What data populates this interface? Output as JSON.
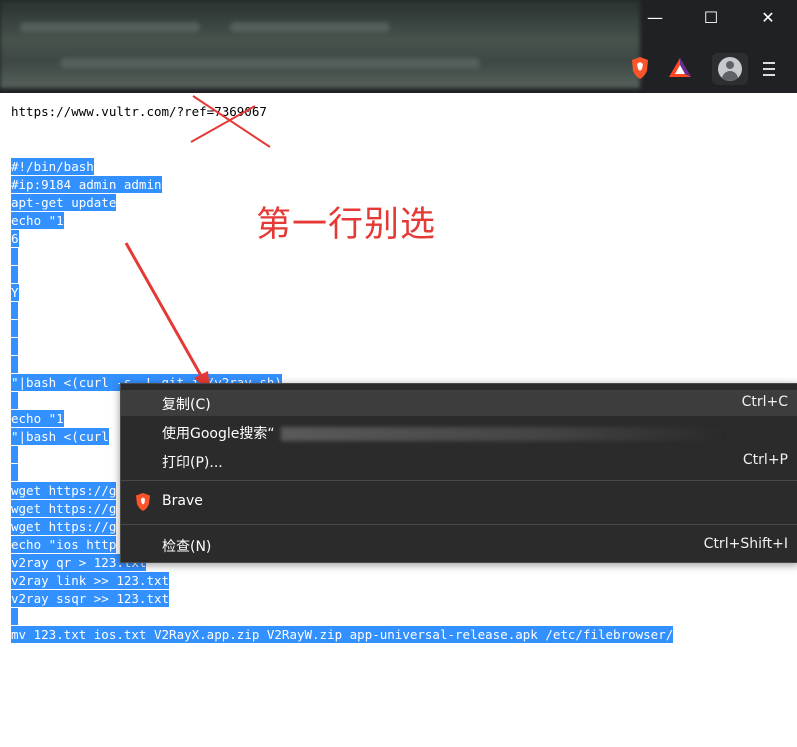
{
  "window": {
    "minimize": "—",
    "maximize": "☐",
    "close": "✕"
  },
  "toolbar": {
    "icons": [
      "brave-shield-icon",
      "brave-rewards-icon",
      "profile-icon",
      "menu-icon"
    ]
  },
  "page": {
    "url_text": "https://www.vultr.com/?ref=7369067",
    "script_lines": [
      "#!/bin/bash",
      "#ip:9184 admin admin",
      "apt-get update",
      "echo \"1",
      "6",
      "Y",
      "\"|bash <(curl -s -L git.io/v2ray.sh)",
      "echo \"1",
      "\"|bash <(curl",
      "wget https://g",
      "wget https://g",
      "wget https://g",
      "echo \"ios http",
      "v2ray qr > 123.txt",
      "v2ray link >> 123.txt",
      "v2ray ssqr >> 123.txt",
      "mv 123.txt ios.txt V2RayX.app.zip V2RayW.zip app-universal-release.apk /etc/filebrowser/"
    ],
    "annotation": "第一行别选"
  },
  "context_menu": {
    "items": [
      {
        "label": "复制(C)",
        "shortcut": "Ctrl+C"
      },
      {
        "label": "使用Google搜索“",
        "shortcut": ""
      },
      {
        "label": "打印(P)...",
        "shortcut": "Ctrl+P"
      },
      {
        "label": "Brave",
        "shortcut": ""
      },
      {
        "label": "检查(N)",
        "shortcut": "Ctrl+Shift+I"
      }
    ]
  },
  "colors": {
    "selection": "#3390ff",
    "annotation": "#e53935",
    "menu_bg": "#2b2b2b"
  }
}
